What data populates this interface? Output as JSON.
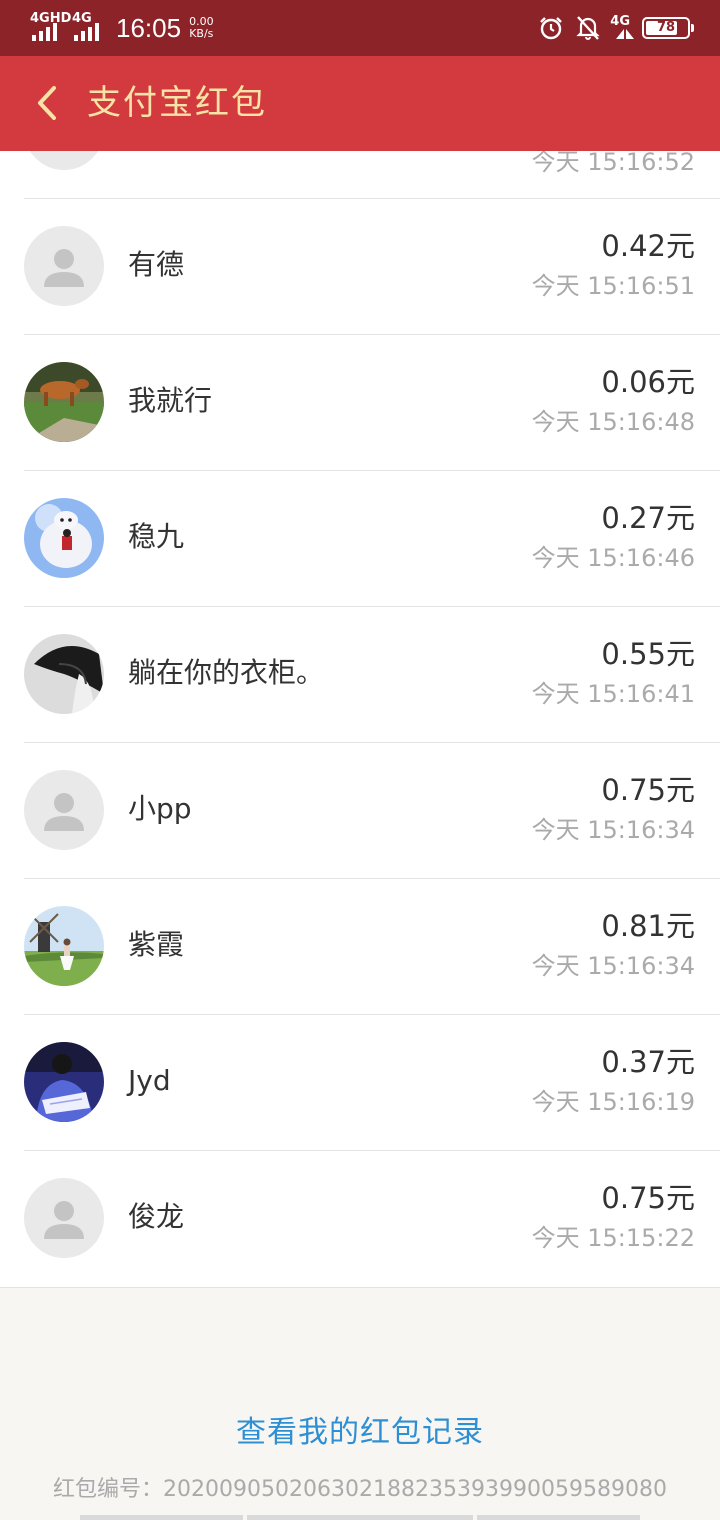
{
  "status_bar": {
    "signal1_label": "4GHD",
    "signal2_label": "4G",
    "time": "16:05",
    "speed_value": "0.00",
    "speed_unit": "KB/s",
    "network_label": "4G",
    "battery": "78",
    "icons": [
      "alarm-icon",
      "bell-off-icon",
      "volte-icon",
      "battery-icon"
    ]
  },
  "header": {
    "back_icon": "chevron-left-icon",
    "title": "支付宝红包"
  },
  "partial_row": {
    "time": "今天 15:16:52"
  },
  "records": [
    {
      "name": "有德",
      "amount": "0.42元",
      "time": "今天 15:16:51",
      "avatar": "default"
    },
    {
      "name": "我就行",
      "amount": "0.06元",
      "time": "今天 15:16:48",
      "avatar": "photo-cow"
    },
    {
      "name": "稳九",
      "amount": "0.27元",
      "time": "今天 15:16:46",
      "avatar": "photo-baymax"
    },
    {
      "name": "躺在你的衣柜。",
      "amount": "0.55元",
      "time": "今天 15:16:41",
      "avatar": "photo-bw-portrait"
    },
    {
      "name": "小pp",
      "amount": "0.75元",
      "time": "今天 15:16:34",
      "avatar": "default"
    },
    {
      "name": "紫霞",
      "amount": "0.81元",
      "time": "今天 15:16:34",
      "avatar": "photo-windmill"
    },
    {
      "name": "Jyd",
      "amount": "0.37元",
      "time": "今天 15:16:19",
      "avatar": "photo-reading"
    },
    {
      "name": "俊龙",
      "amount": "0.75元",
      "time": "今天 15:15:22",
      "avatar": "default"
    }
  ],
  "footer": {
    "record_link": "查看我的红包记录",
    "serial": "红包编号：20200905020630218823539399005958​9080"
  },
  "colors": {
    "status_bar": "#8c2329",
    "header": "#d33a3f",
    "header_text": "#f8e3a6",
    "link": "#2f8fd3"
  }
}
